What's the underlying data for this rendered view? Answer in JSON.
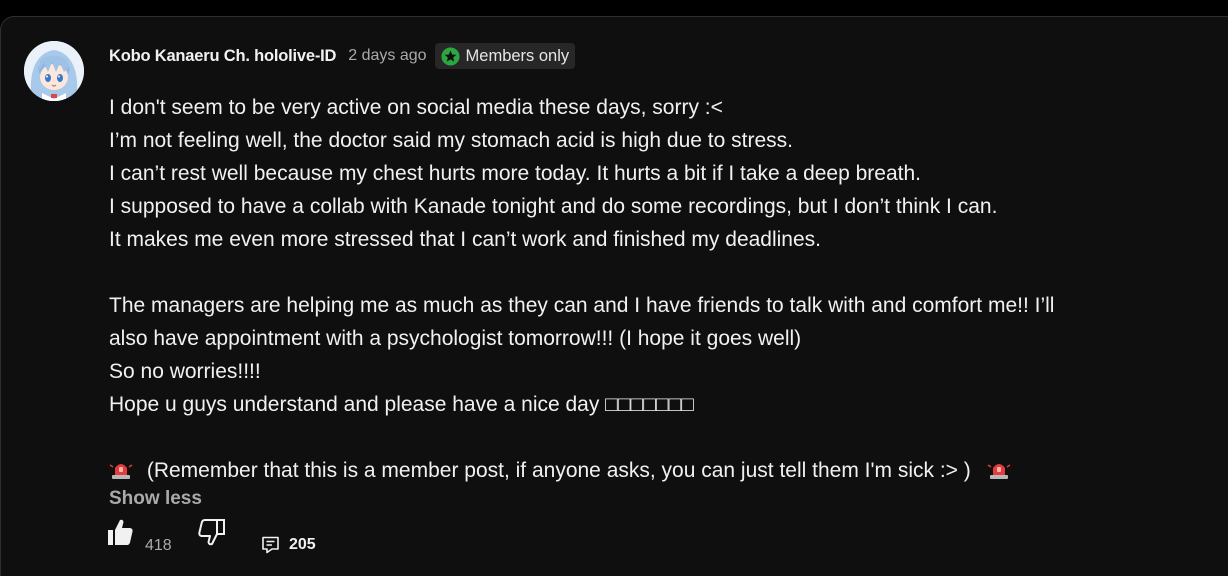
{
  "post": {
    "author": "Kobo Kanaeru Ch. hololive-ID",
    "timestamp": "2 days ago",
    "badge_label": "Members only",
    "body_lines": [
      "I don't seem to be very active on social media these days, sorry :<",
      "I’m not feeling well, the doctor said my stomach acid is high due to stress.",
      "I can’t rest well because my chest hurts more today. It hurts a bit if I take a deep breath.",
      "I supposed to have a collab with Kanade tonight and do some recordings, but I don’t think I can.",
      "It makes me even more stressed that I can’t work and finished my deadlines.",
      "",
      "The managers are helping me as much as they can and I have friends to talk with and comfort me!! I’ll",
      "also have appointment with a psychologist tomorrow!!! (I hope it goes well)",
      "So no worries!!!!",
      "Hope u guys understand and please have a nice day □□□□□□□",
      "",
      "(Remember that this is a member post, if anyone asks, you can just tell them I'm sick :> )"
    ],
    "show_less_label": "Show less"
  },
  "actions": {
    "like_count": "418",
    "comment_count": "205"
  },
  "icons": {
    "badge": "members-star-icon",
    "siren": "police-light-icon",
    "like": "thumbs-up-icon",
    "dislike": "thumbs-down-icon",
    "comment": "comment-icon"
  },
  "colors": {
    "background": "#0f0f0f",
    "badge_bg": "#272727",
    "badge_green": "#2ba640",
    "secondary_text": "#aaaaaa",
    "siren_red": "#e23c3c"
  }
}
